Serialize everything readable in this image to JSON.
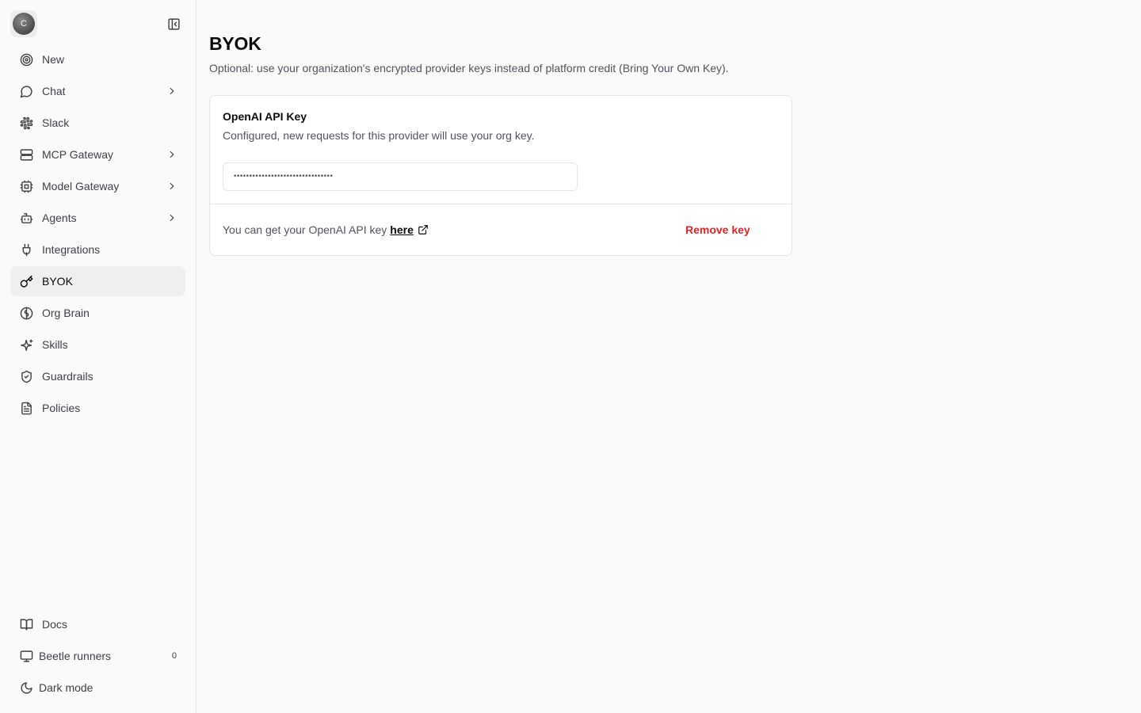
{
  "app": {
    "avatar_initial": "C"
  },
  "sidebar": {
    "items": [
      {
        "label": "New",
        "icon": "target-icon",
        "has_chevron": false,
        "active": false
      },
      {
        "label": "Chat",
        "icon": "message-circle-icon",
        "has_chevron": true,
        "active": false
      },
      {
        "label": "Slack",
        "icon": "slack-icon",
        "has_chevron": false,
        "active": false
      },
      {
        "label": "MCP Gateway",
        "icon": "server-icon",
        "has_chevron": true,
        "active": false
      },
      {
        "label": "Model Gateway",
        "icon": "cpu-icon",
        "has_chevron": true,
        "active": false
      },
      {
        "label": "Agents",
        "icon": "bot-icon",
        "has_chevron": true,
        "active": false
      },
      {
        "label": "Integrations",
        "icon": "plug-icon",
        "has_chevron": false,
        "active": false
      },
      {
        "label": "BYOK",
        "icon": "key-icon",
        "has_chevron": false,
        "active": true
      },
      {
        "label": "Org Brain",
        "icon": "brain-icon",
        "has_chevron": false,
        "active": false
      },
      {
        "label": "Skills",
        "icon": "sparkles-icon",
        "has_chevron": false,
        "active": false
      },
      {
        "label": "Guardrails",
        "icon": "shield-check-icon",
        "has_chevron": false,
        "active": false
      },
      {
        "label": "Policies",
        "icon": "file-text-icon",
        "has_chevron": false,
        "active": false
      }
    ],
    "bottom": {
      "docs": "Docs",
      "runners": "Beetle runners",
      "runners_count": "0",
      "dark_mode": "Dark mode"
    }
  },
  "main": {
    "title": "BYOK",
    "subtitle": "Optional: use your organization's encrypted provider keys instead of platform credit (Bring Your Own Key).",
    "card": {
      "title": "OpenAI API Key",
      "description": "Configured, new requests for this provider will use your org key.",
      "key_value": "••••••••••••••••••••••••••••••••",
      "footer_text": "You can get your OpenAI API key",
      "link_label": "here",
      "remove_label": "Remove key"
    }
  },
  "colors": {
    "accent_danger": "#dc2626",
    "background": "#fafafa",
    "card": "#ffffff",
    "border": "#e5e5e5"
  }
}
